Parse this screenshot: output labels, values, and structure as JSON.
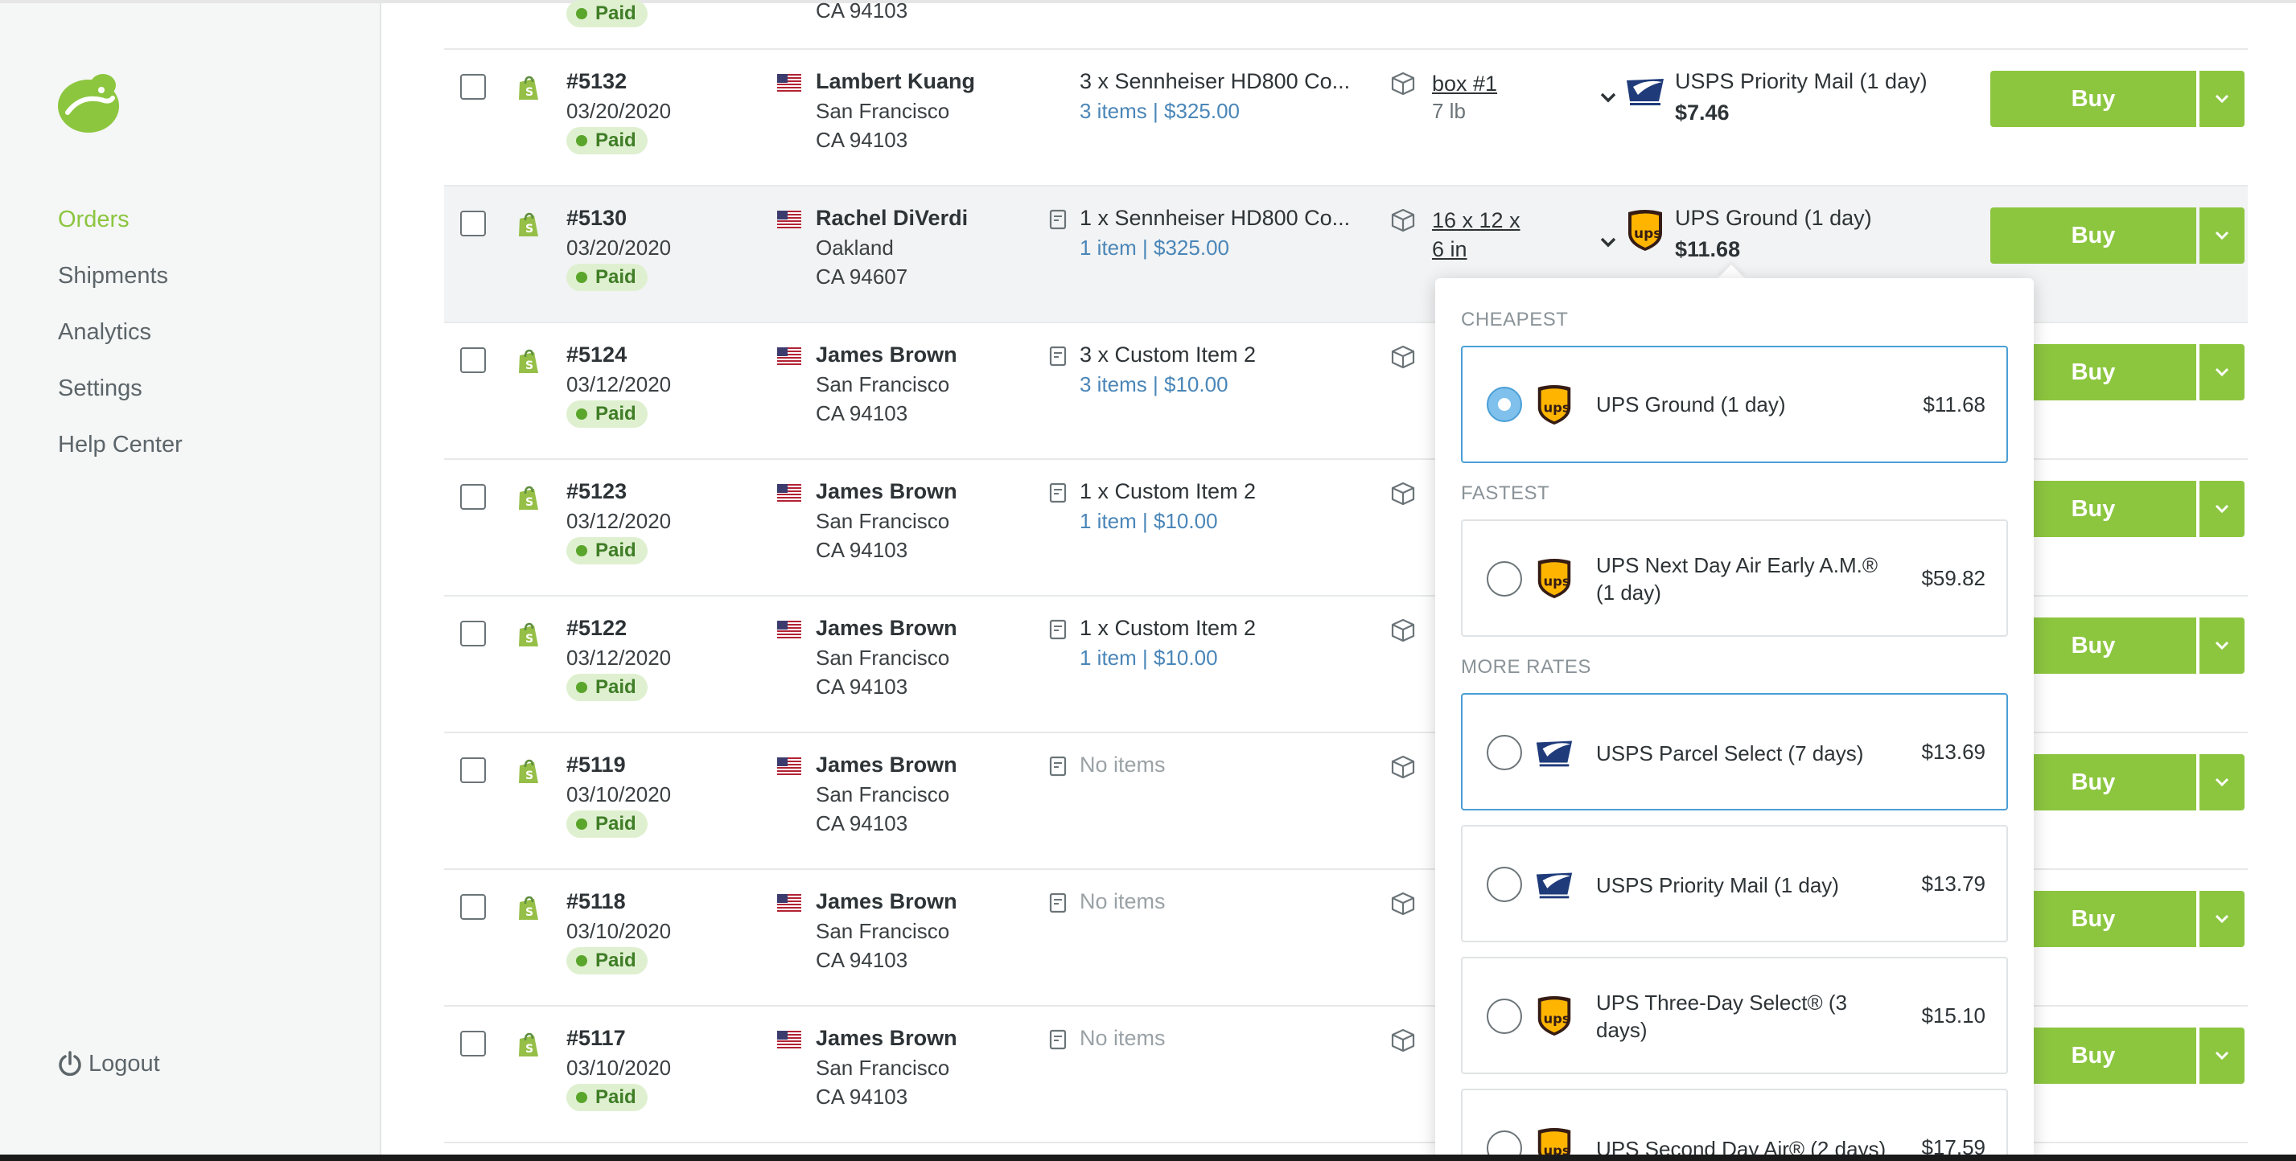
{
  "sidebar": {
    "nav": [
      "Orders",
      "Shipments",
      "Analytics",
      "Settings",
      "Help Center"
    ],
    "logout": "Logout"
  },
  "partial_row": {
    "status": "Paid",
    "zip": "CA 94103"
  },
  "orders": [
    {
      "number": "#5132",
      "date": "03/20/2020",
      "status": "Paid",
      "name": "Lambert Kuang",
      "city": "San Francisco",
      "zip": "CA 94103",
      "item": "3 x Sennheiser HD800 Co...",
      "item_sub": "3 items | $325.00",
      "package": "box #1",
      "package_sub": "7 lb",
      "carrier": "usps",
      "service": "USPS Priority Mail  (1 day)",
      "price": "$7.46",
      "buy": "Buy"
    },
    {
      "number": "#5130",
      "date": "03/20/2020",
      "status": "Paid",
      "name": "Rachel DiVerdi",
      "city": "Oakland",
      "zip": "CA 94607",
      "item": "1 x Sennheiser HD800 Co...",
      "item_sub": "1 item | $325.00",
      "package": "16 x 12 x 6 in",
      "package_sub": "",
      "carrier": "ups",
      "service": "UPS Ground  (1 day)",
      "price": "$11.68",
      "buy": "Buy"
    },
    {
      "number": "#5124",
      "date": "03/12/2020",
      "status": "Paid",
      "name": "James Brown",
      "city": "San Francisco",
      "zip": "CA 94103",
      "item": "3 x Custom Item 2",
      "item_sub": "3 items | $10.00",
      "buy": "Buy"
    },
    {
      "number": "#5123",
      "date": "03/12/2020",
      "status": "Paid",
      "name": "James Brown",
      "city": "San Francisco",
      "zip": "CA 94103",
      "item": "1 x Custom Item 2",
      "item_sub": "1 item | $10.00",
      "buy": "Buy"
    },
    {
      "number": "#5122",
      "date": "03/12/2020",
      "status": "Paid",
      "name": "James Brown",
      "city": "San Francisco",
      "zip": "CA 94103",
      "item": "1 x Custom Item 2",
      "item_sub": "1 item | $10.00",
      "buy": "Buy"
    },
    {
      "number": "#5119",
      "date": "03/10/2020",
      "status": "Paid",
      "name": "James Brown",
      "city": "San Francisco",
      "zip": "CA 94103",
      "item": "No items",
      "item_sub": "",
      "buy": "Buy"
    },
    {
      "number": "#5118",
      "date": "03/10/2020",
      "status": "Paid",
      "name": "James Brown",
      "city": "San Francisco",
      "zip": "CA 94103",
      "item": "No items",
      "item_sub": "",
      "buy": "Buy"
    },
    {
      "number": "#5117",
      "date": "03/10/2020",
      "status": "Paid",
      "name": "James Brown",
      "city": "San Francisco",
      "zip": "CA 94103",
      "item": "No items",
      "item_sub": "",
      "buy": "Buy"
    }
  ],
  "rates_dropdown": {
    "sections": {
      "cheapest": "CHEAPEST",
      "fastest": "FASTEST",
      "more": "MORE RATES"
    },
    "options": [
      {
        "carrier": "ups",
        "name": "UPS Ground  (1 day)",
        "price": "$11.68",
        "selected": true
      },
      {
        "carrier": "ups",
        "name": "UPS Next Day Air Early A.M.®  (1 day)",
        "price": "$59.82",
        "selected": false
      },
      {
        "carrier": "usps",
        "name": "USPS Parcel Select  (7 days)",
        "price": "$13.69",
        "selected": false,
        "highlighted": true
      },
      {
        "carrier": "usps",
        "name": "USPS Priority Mail  (1 day)",
        "price": "$13.79",
        "selected": false
      },
      {
        "carrier": "ups",
        "name": "UPS Three-Day Select®  (3 days)",
        "price": "$15.10",
        "selected": false
      },
      {
        "carrier": "ups",
        "name": "UPS Second Day Air®  (2 days)",
        "price": "$17.59",
        "selected": false
      }
    ]
  },
  "colors": {
    "brand_green": "#8cc63f",
    "select_blue": "#4a9fd6",
    "paid_bg": "#dff0d0",
    "link_blue": "#4a86b8"
  }
}
